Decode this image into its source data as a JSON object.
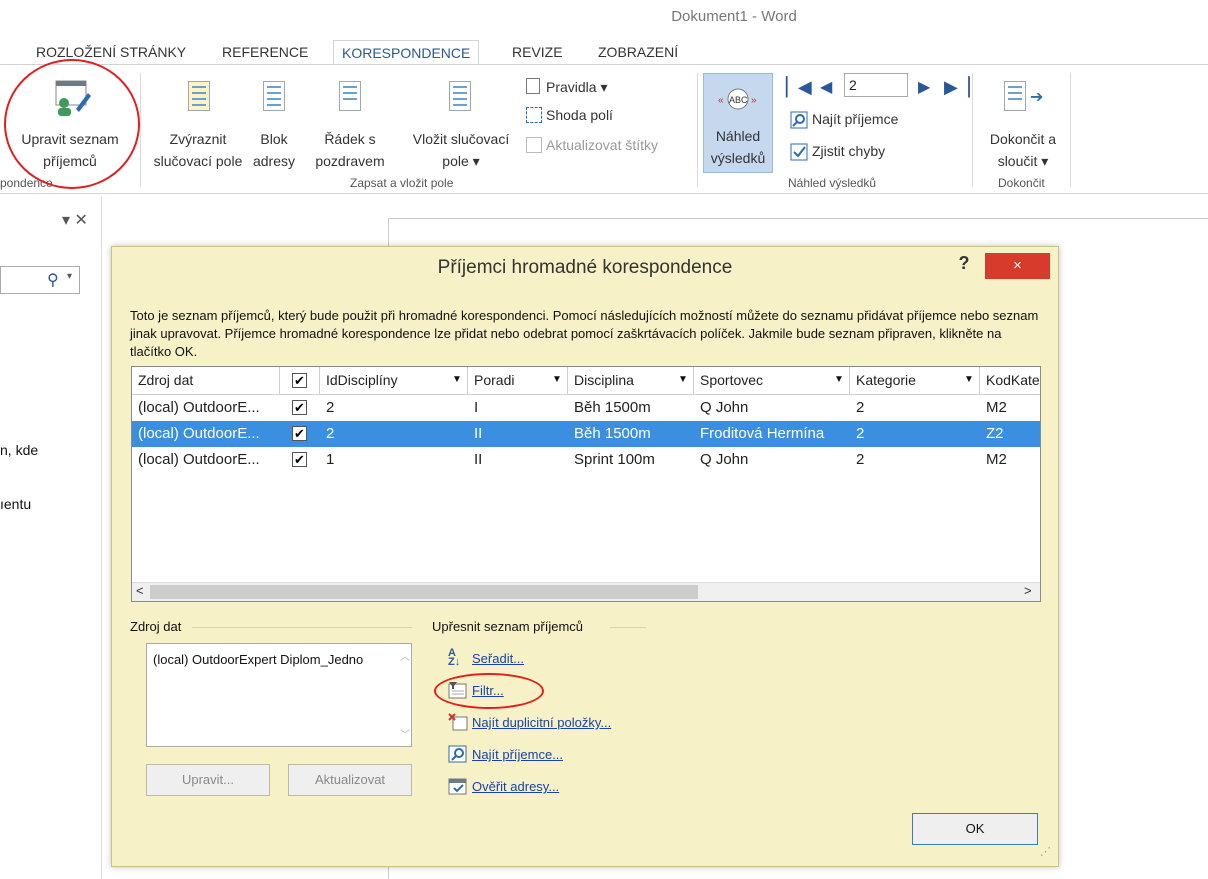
{
  "window": {
    "title": "Dokument1 - Word"
  },
  "tabs": [
    {
      "label": "ROZLOŽENÍ STRÁNKY"
    },
    {
      "label": "REFERENCE"
    },
    {
      "label": "KORESPONDENCE"
    },
    {
      "label": "REVIZE"
    },
    {
      "label": "ZOBRAZENÍ"
    }
  ],
  "ribbon": {
    "edit_list": {
      "line1": "Upravit seznam",
      "line2": "příjemců"
    },
    "group1_label": "pondence",
    "highlight": {
      "line1": "Zvýraznit",
      "line2": "slučovací pole"
    },
    "block": {
      "line1": "Blok",
      "line2": "adresy"
    },
    "greeting": {
      "line1": "Řádek s",
      "line2": "pozdravem"
    },
    "insert_field": {
      "line1": "Vložit slučovací",
      "line2": "pole ▾"
    },
    "rules": "Pravidla ▾",
    "match_fields": "Shoda polí",
    "update_labels": "Aktualizovat štítky",
    "group2_label": "Zapsat a vložit pole",
    "preview": {
      "line1": "Náhled",
      "line2": "výsledků"
    },
    "record_number": "2",
    "find_recipient": "Najít příjemce",
    "check_errors": "Zjistit chyby",
    "group3_label": "Náhled výsledků",
    "finish": {
      "line1": "Dokončit a",
      "line2": "sloučit ▾"
    },
    "group4_label": "Dokončit"
  },
  "nav": {
    "close": "▾ ✕",
    "snippet1": "n, kde",
    "snippet2": "ıentu"
  },
  "dialog": {
    "title": "Příjemci hromadné korespondence",
    "help": "?",
    "close": "×",
    "description": "Toto je seznam příjemců, který bude použit při hromadné korespondenci. Pomocí následujících možností můžete do seznamu přidávat příjemce nebo seznam jinak upravovat. Příjemce hromadné korespondence lze přidat nebo odebrat pomocí zaškrtávacích políček. Jakmile bude seznam připraven, klikněte na tlačítko OK.",
    "columns": [
      "Zdroj dat",
      "",
      "IdDisciplíny",
      "Poradi",
      "Disciplina",
      "Sportovec",
      "Kategorie",
      "KodKate"
    ],
    "rows": [
      {
        "source": "(local) OutdoorE...",
        "checked": "✔",
        "id": "2",
        "poradi": "I",
        "disciplina": "Běh 1500m",
        "sportovec": "Q John",
        "kategorie": "2",
        "kod": "M2"
      },
      {
        "source": "(local) OutdoorE...",
        "checked": "✔",
        "id": "2",
        "poradi": "II",
        "disciplina": "Běh 1500m",
        "sportovec": "Froditová Hermína",
        "kategorie": "2",
        "kod": "Z2"
      },
      {
        "source": "(local) OutdoorE...",
        "checked": "✔",
        "id": "1",
        "poradi": "II",
        "disciplina": "Sprint 100m",
        "sportovec": "Q John",
        "kategorie": "2",
        "kod": "M2"
      }
    ],
    "header_checked": "✔",
    "data_source_label": "Zdroj dat",
    "data_source_item": "(local) OutdoorExpert Diplom_Jedno",
    "edit_button": "Upravit...",
    "refresh_button": "Aktualizovat",
    "refine_label": "Upřesnit seznam příjemců",
    "links": {
      "sort": "Seřadit...",
      "filter": "Filtr...",
      "duplicates": "Najít duplicitní položky...",
      "find": "Najít příjemce...",
      "verify": "Ověřit adresy..."
    },
    "ok_button": "OK"
  },
  "colors": {
    "accent": "#2b579a",
    "selection": "#3b8fe0",
    "dialog_bg": "#f6f1c6",
    "close_red": "#d63b2c",
    "annotation_red": "#e02020"
  }
}
